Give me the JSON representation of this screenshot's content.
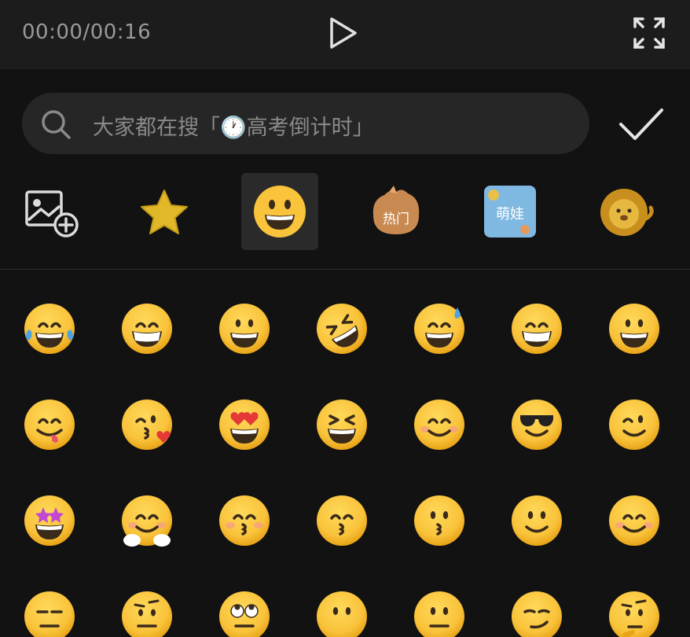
{
  "player": {
    "time": "00:00/00:16",
    "play_icon": "play-icon",
    "fullscreen_icon": "fullscreen-icon"
  },
  "search": {
    "placeholder": "大家都在搜「🕐高考倒计时」",
    "icon": "search-icon",
    "confirm_icon": "checkmark-icon"
  },
  "categories": [
    {
      "name": "add-image",
      "icon": "image-add-icon",
      "active": false
    },
    {
      "name": "favorites",
      "icon": "star-icon",
      "active": false
    },
    {
      "name": "emoji",
      "icon": "grinning-face-icon",
      "active": true
    },
    {
      "name": "hot",
      "label": "热门",
      "icon": "hot-sticker-icon",
      "active": false
    },
    {
      "name": "cute",
      "label": "萌娃",
      "icon": "cute-sticker-icon",
      "active": false
    },
    {
      "name": "lion",
      "icon": "lion-sticker-icon",
      "active": false
    }
  ],
  "emojis": [
    [
      "tears-of-joy",
      "beaming-grin",
      "grinning",
      "rolling-laughing",
      "grin-sweat",
      "grin-smiling-eyes",
      "smiley"
    ],
    [
      "yum",
      "kissing-heart",
      "heart-eyes",
      "laughing",
      "blush",
      "sunglasses",
      "wink"
    ],
    [
      "star-struck",
      "hugging",
      "kissing-closed-eyes",
      "kissing-smiling-eyes",
      "kissing",
      "slight-smile",
      "smiling-relaxed"
    ],
    [
      "expressionless",
      "raised-eyebrow",
      "rolling-eyes",
      "no-mouth",
      "neutral",
      "smirk",
      "thinking"
    ]
  ],
  "colors": {
    "emoji_yellow": "#F9C33B",
    "emoji_shade": "#E8A317",
    "background": "#121212",
    "search_bg": "#262626"
  }
}
